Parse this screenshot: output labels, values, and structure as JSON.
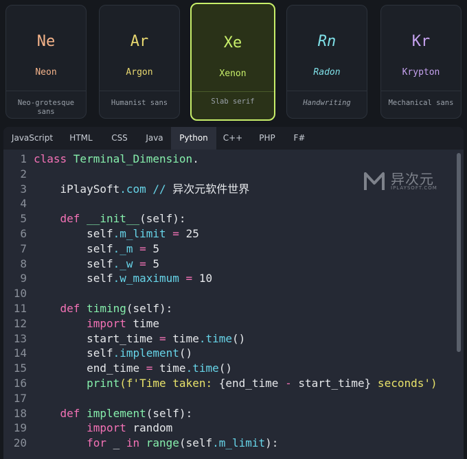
{
  "cards": [
    {
      "symbol": "Ne",
      "name": "Neon",
      "desc": "Neo-grotesque sans",
      "color": "#f4b38a"
    },
    {
      "symbol": "Ar",
      "name": "Argon",
      "desc": "Humanist sans",
      "color": "#e8d870"
    },
    {
      "symbol": "Xe",
      "name": "Xenon",
      "desc": "Slab serif",
      "color": "#c8ef6a",
      "selected": true
    },
    {
      "symbol": "Rn",
      "name": "Radon",
      "desc": "Handwriting",
      "color": "#7fe0e8"
    },
    {
      "symbol": "Kr",
      "name": "Krypton",
      "desc": "Mechanical sans",
      "color": "#c6a2f0"
    }
  ],
  "tabs": [
    "JavaScript",
    "HTML",
    "CSS",
    "Java",
    "Python",
    "C++",
    "PHP",
    "F#"
  ],
  "active_tab": "Python",
  "watermark": {
    "title": "异次元",
    "subtitle": "IPLAYSOFT.COM"
  },
  "code": {
    "line_numbers": [
      "1",
      "2",
      "3",
      "4",
      "5",
      "6",
      "7",
      "8",
      "9",
      "10",
      "11",
      "12",
      "13",
      "14",
      "15",
      "16",
      "17",
      "18",
      "19",
      "20"
    ],
    "lines": [
      [
        [
          "kw",
          "class "
        ],
        [
          "fn",
          "Terminal_Dimension"
        ],
        [
          "",
          "."
        ]
      ],
      [],
      [
        [
          "",
          "    iPlaySoft"
        ],
        [
          "at",
          ".com"
        ],
        [
          "cm",
          " // "
        ],
        [
          "",
          "异次元软件世界"
        ]
      ],
      [],
      [
        [
          "kw",
          "    def "
        ],
        [
          "fn",
          "__init__"
        ],
        [
          "",
          "(self):"
        ]
      ],
      [
        [
          "",
          "        self"
        ],
        [
          "at",
          ".m_limit"
        ],
        [
          "op",
          " = "
        ],
        [
          "",
          "25"
        ]
      ],
      [
        [
          "",
          "        self"
        ],
        [
          "at",
          "._m"
        ],
        [
          "op",
          " = "
        ],
        [
          "",
          "5"
        ]
      ],
      [
        [
          "",
          "        self"
        ],
        [
          "at",
          "._w"
        ],
        [
          "op",
          " = "
        ],
        [
          "",
          "5"
        ]
      ],
      [
        [
          "",
          "        self"
        ],
        [
          "at",
          ".w_maximum"
        ],
        [
          "op",
          " = "
        ],
        [
          "",
          "10"
        ]
      ],
      [],
      [
        [
          "kw",
          "    def "
        ],
        [
          "fn",
          "timing"
        ],
        [
          "",
          "(self):"
        ]
      ],
      [
        [
          "kw",
          "        import "
        ],
        [
          "",
          "time"
        ]
      ],
      [
        [
          "",
          "        start_time"
        ],
        [
          "op",
          " = "
        ],
        [
          "",
          "time"
        ],
        [
          "at",
          ".time"
        ],
        [
          "",
          "()"
        ]
      ],
      [
        [
          "",
          "        self"
        ],
        [
          "at",
          ".implement"
        ],
        [
          "",
          "()"
        ]
      ],
      [
        [
          "",
          "        end_time"
        ],
        [
          "op",
          " = "
        ],
        [
          "",
          "time"
        ],
        [
          "at",
          ".time"
        ],
        [
          "",
          "()"
        ]
      ],
      [
        [
          "fn",
          "        print"
        ],
        [
          "st",
          "(f'Time taken: "
        ],
        [
          "",
          "{end_time "
        ],
        [
          "op",
          "-"
        ],
        [
          "",
          " start_time}"
        ],
        [
          "st",
          " seconds')"
        ]
      ],
      [],
      [
        [
          "kw",
          "    def "
        ],
        [
          "fn",
          "implement"
        ],
        [
          "",
          "(self):"
        ]
      ],
      [
        [
          "kw",
          "        import "
        ],
        [
          "",
          "random"
        ]
      ],
      [
        [
          "kw",
          "        for "
        ],
        [
          "",
          "_ "
        ],
        [
          "kw",
          "in "
        ],
        [
          "fn",
          "range"
        ],
        [
          "",
          "(self"
        ],
        [
          "at",
          ".m_limit"
        ],
        [
          "",
          "):"
        ]
      ]
    ]
  }
}
